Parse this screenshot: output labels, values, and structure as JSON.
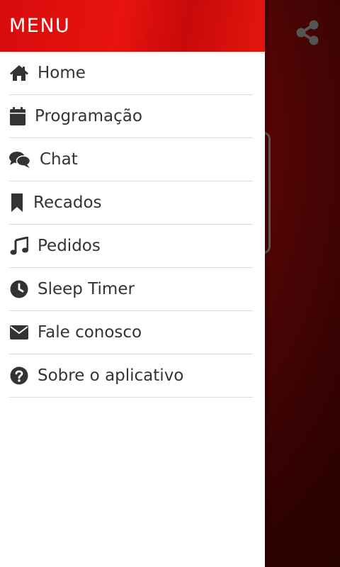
{
  "drawer": {
    "title": "MENU",
    "items": [
      {
        "label": "Home",
        "icon": "home-icon"
      },
      {
        "label": "Programação",
        "icon": "calendar-icon"
      },
      {
        "label": "Chat",
        "icon": "chat-icon"
      },
      {
        "label": "Recados",
        "icon": "bookmark-icon"
      },
      {
        "label": "Pedidos",
        "icon": "music-note-icon"
      },
      {
        "label": "Sleep Timer",
        "icon": "clock-icon"
      },
      {
        "label": "Fale conosco",
        "icon": "envelope-icon"
      },
      {
        "label": "Sobre o aplicativo",
        "icon": "question-circle-icon"
      }
    ]
  },
  "background": {
    "share_icon": "share-icon"
  },
  "colors": {
    "header_red": "#e8130f",
    "background_dark_red": "#4a0404",
    "text": "#333333",
    "icon": "#333333"
  }
}
